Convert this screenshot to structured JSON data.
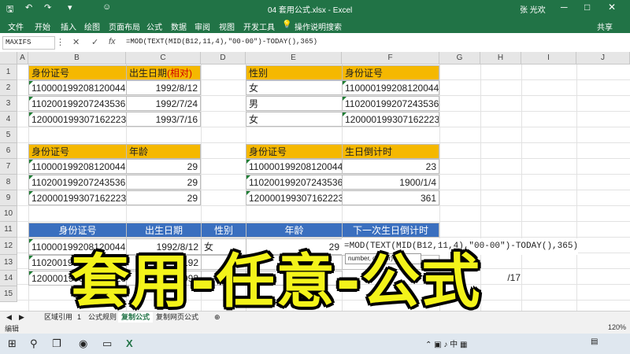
{
  "window": {
    "title": "04 套用公式.xlsx - Excel",
    "user": "张 光欢",
    "controls": [
      "─",
      "□",
      "✕"
    ]
  },
  "quick_access": [
    "save-icon",
    "undo-icon",
    "redo-icon",
    "smiley-icon"
  ],
  "ribbon": {
    "tabs": [
      "文件",
      "开始",
      "插入",
      "绘图",
      "页面布局",
      "公式",
      "数据",
      "审阅",
      "视图",
      "开发工具"
    ],
    "tell_me": "操作说明搜索",
    "share": "共享"
  },
  "formula_bar": {
    "name_box": "MAXIFS",
    "cancel": "✕",
    "enter": "✓",
    "fx": "fx",
    "formula": "=MOD(TEXT(MID(B12,11,4),\"00-00\")-TODAY(),365)"
  },
  "columns": [
    "A",
    "B",
    "C",
    "D",
    "E",
    "F",
    "G",
    "H",
    "I",
    "J"
  ],
  "rows": [
    "1",
    "2",
    "3",
    "4",
    "5",
    "6",
    "7",
    "8",
    "9",
    "10",
    "11",
    "12",
    "13",
    "14",
    "15"
  ],
  "table1": {
    "headers": [
      "身份证号",
      "出生日期",
      "(相对)"
    ],
    "rows": [
      [
        "110000199208120044",
        "1992/8/12"
      ],
      [
        "110200199207243536",
        "1992/7/24"
      ],
      [
        "120000199307162223",
        "1993/7/16"
      ]
    ]
  },
  "table2": {
    "headers": [
      "性别",
      "身份证号"
    ],
    "rows": [
      [
        "女",
        "110000199208120044"
      ],
      [
        "男",
        "110200199207243536"
      ],
      [
        "女",
        "120000199307162223"
      ]
    ]
  },
  "table3": {
    "headers": [
      "身份证号",
      "年龄"
    ],
    "rows": [
      [
        "110000199208120044",
        "29"
      ],
      [
        "110200199207243536",
        "29"
      ],
      [
        "120000199307162223",
        "29"
      ]
    ]
  },
  "table4": {
    "headers": [
      "身份证号",
      "生日倒计时"
    ],
    "rows": [
      [
        "110000199208120044",
        "23"
      ],
      [
        "110200199207243536",
        "1900/1/4"
      ],
      [
        "120000199307162223",
        "361"
      ]
    ]
  },
  "table5": {
    "headers": [
      "身份证号",
      "出生日期",
      "性别",
      "年龄",
      "下一次生日倒计时"
    ],
    "row12": [
      "110000199208120044",
      "1992/8/12",
      "女",
      "29",
      "=MOD(TEXT(MID(B12,11,4),\"00-00\")-TODAY(),365)"
    ],
    "row13": [
      "110200199207243536",
      "192"
    ],
    "row14": [
      "120000199307162223",
      "1993",
      "/17"
    ]
  },
  "tooltip": "number, divisor)",
  "banner": "套用-任意-公式",
  "sheet_tabs": [
    "区域引用",
    "1",
    "公式规则",
    "复制公式",
    "复制网页公式"
  ],
  "active_sheet": "复制公式",
  "status": {
    "mode": "编辑",
    "zoom": "120%"
  },
  "accent_colors": {
    "excel_green": "#217346",
    "header_orange": "#f5b800",
    "header_blue": "#3a6fbf",
    "banner_yellow": "#f3f31a"
  }
}
